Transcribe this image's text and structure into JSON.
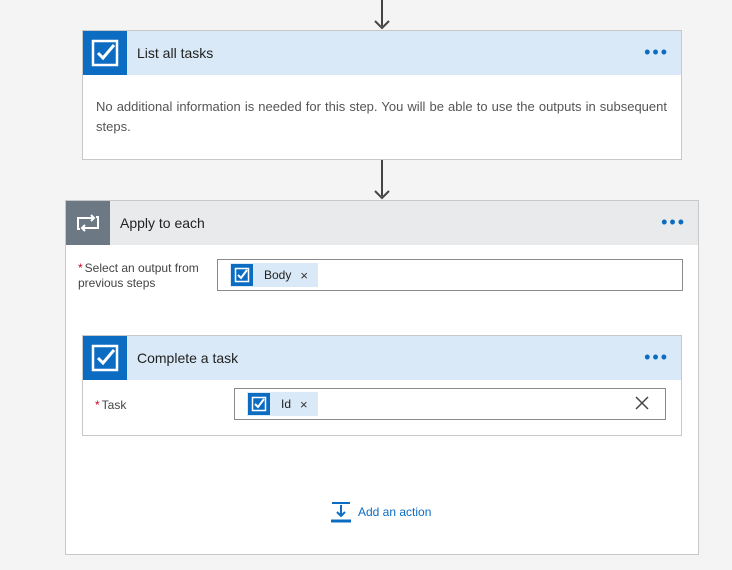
{
  "steps": {
    "list_tasks": {
      "title": "List all tasks",
      "menu": "•••",
      "info": "No additional information is needed for this step. You will be able to use the outputs in subsequent steps."
    },
    "apply_each": {
      "title": "Apply to each",
      "menu": "•••",
      "field_required": "*",
      "field_label": "Select an output from previous steps",
      "token_label": "Body",
      "token_remove": "×",
      "add_action_label": "Add an action"
    },
    "complete_task": {
      "title": "Complete a task",
      "menu": "•••",
      "field_required": "*",
      "field_label": "Task",
      "token_label": "Id",
      "token_remove": "×"
    }
  },
  "colors": {
    "accent": "#0b6cc2",
    "header_blue": "#d9e9f7",
    "header_gray": "#e8eaec",
    "required": "#d0021b"
  },
  "icons": {
    "task": "checkbox-icon",
    "loop": "loop-icon",
    "add": "add-action-icon",
    "connector": "arrow-down-icon"
  }
}
